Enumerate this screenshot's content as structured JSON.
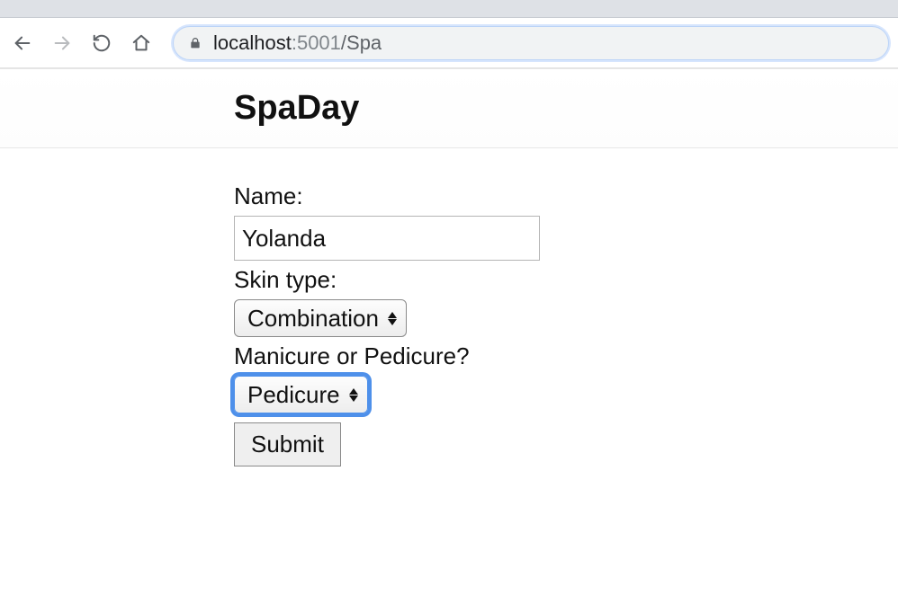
{
  "browser": {
    "url": {
      "host": "localhost",
      "port": ":5001",
      "path": "/Spa"
    }
  },
  "page": {
    "title": "SpaDay"
  },
  "form": {
    "name_label": "Name:",
    "name_value": "Yolanda",
    "skin_label": "Skin type:",
    "skin_value": "Combination",
    "service_label": "Manicure or Pedicure?",
    "service_value": "Pedicure",
    "submit_label": "Submit"
  }
}
